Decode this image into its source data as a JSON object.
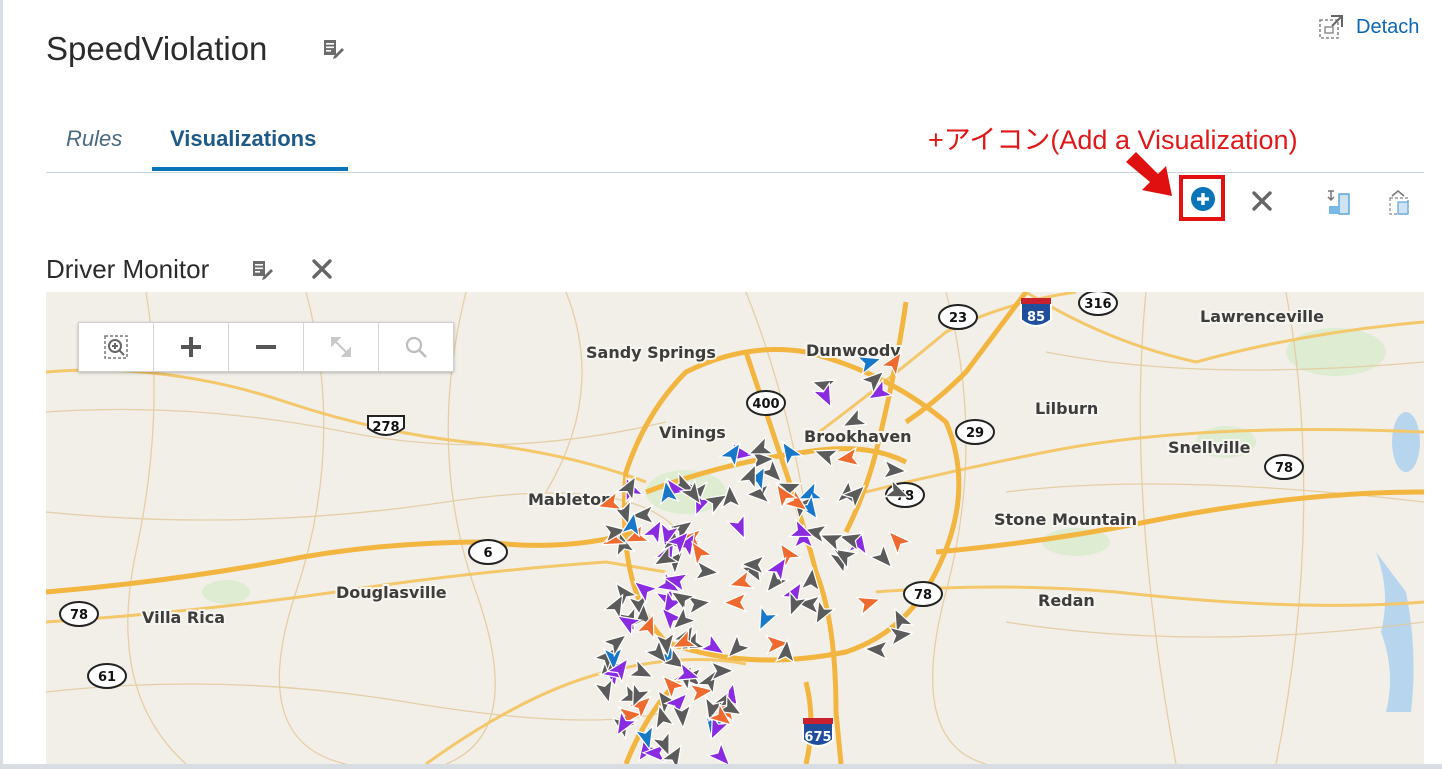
{
  "header": {
    "title": "SpeedViolation",
    "detach_label": "Detach"
  },
  "tabs": [
    {
      "label": "Rules",
      "selected": false
    },
    {
      "label": "Visualizations",
      "selected": true
    }
  ],
  "annotation": {
    "text": "+アイコン(Add a Visualization)",
    "color": "#e11818"
  },
  "toolbar": {
    "icons": [
      "add-circle-icon",
      "close-icon",
      "layout-icon",
      "flip-layout-icon"
    ]
  },
  "visualization": {
    "title": "Driver Monitor",
    "map_tools": [
      "zoom-to-fit-icon",
      "zoom-in-icon",
      "zoom-out-icon",
      "pan-icon",
      "search-icon"
    ],
    "cities": [
      "Sandy Springs",
      "Dunwoody",
      "Lawrenceville",
      "Lilburn",
      "Vinings",
      "Brookhaven",
      "Snellville",
      "Mableton",
      "Stone Mountain",
      "Douglasville",
      "Villa Rica",
      "Redan"
    ],
    "route_shields": [
      "316",
      "23",
      "400",
      "278",
      "29",
      "78",
      "78",
      "6",
      "78",
      "78",
      "61"
    ],
    "interstate_shields": [
      "85",
      "675"
    ],
    "marker_colors": {
      "gray": "#5b5b5b",
      "purple": "#8a2be2",
      "blue": "#1777c9",
      "orange": "#ef6a2f"
    }
  },
  "colors": {
    "accent": "#0a74b8",
    "link": "#0a66b7",
    "annotation_red": "#e21212"
  }
}
